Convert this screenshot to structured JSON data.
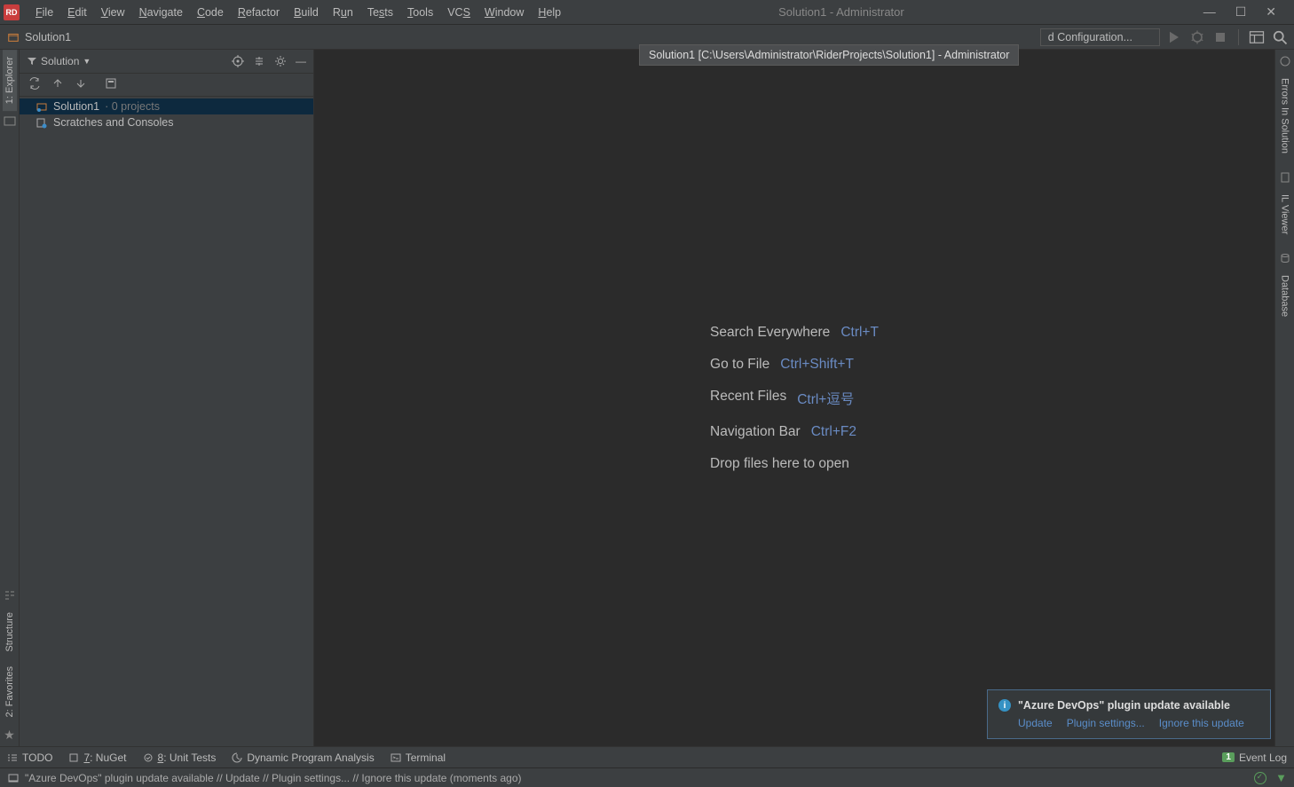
{
  "app": {
    "icon_text": "RD",
    "title": "Solution1 - Administrator"
  },
  "menubar": {
    "file": "File",
    "edit": "Edit",
    "view": "View",
    "navigate": "Navigate",
    "code": "Code",
    "refactor": "Refactor",
    "build": "Build",
    "run": "Run",
    "tests": "Tests",
    "tools": "Tools",
    "vcs": "VCS",
    "window": "Window",
    "help": "Help"
  },
  "toolbar": {
    "breadcrumb": "Solution1",
    "tooltip": "Solution1 [C:\\Users\\Administrator\\RiderProjects\\Solution1] - Administrator",
    "config_label": "d Configuration..."
  },
  "solution_panel": {
    "title": "Solution",
    "tree": {
      "root": "Solution1",
      "root_meta": "· 0 projects",
      "scratches": "Scratches and Consoles"
    }
  },
  "left_tabs": {
    "explorer": "1: Explorer",
    "structure": "Structure",
    "favorites": "2: Favorites"
  },
  "right_tabs": {
    "errors": "Errors In Solution",
    "il_viewer": "IL Viewer",
    "database": "Database"
  },
  "hints": {
    "search_label": "Search Everywhere",
    "search_key": "Ctrl+T",
    "goto_label": "Go to File",
    "goto_key": "Ctrl+Shift+T",
    "recent_label": "Recent Files",
    "recent_key": "Ctrl+逗号",
    "nav_label": "Navigation Bar",
    "nav_key": "Ctrl+F2",
    "drop_label": "Drop files here to open"
  },
  "notification": {
    "title": "\"Azure DevOps\" plugin update available",
    "update": "Update",
    "settings": "Plugin settings...",
    "ignore": "Ignore this update"
  },
  "bottom_tools": {
    "todo": "TODO",
    "nuget": "7: NuGet",
    "unittests": "8: Unit Tests",
    "dpa": "Dynamic Program Analysis",
    "terminal": "Terminal",
    "eventlog": "Event Log",
    "eventlog_badge": "1"
  },
  "statusbar": {
    "message": "\"Azure DevOps\" plugin update available // Update // Plugin settings... // Ignore this update (moments ago)"
  }
}
